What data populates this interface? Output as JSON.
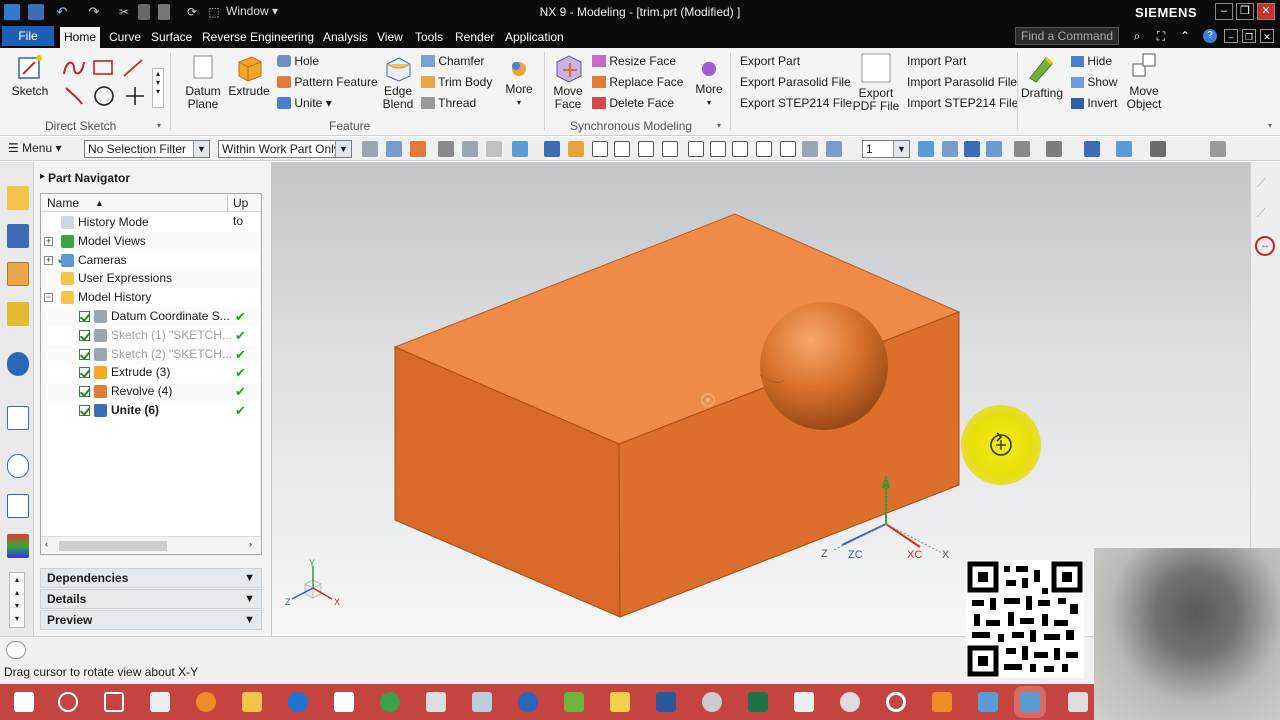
{
  "titlebar": {
    "window_menu": "Window",
    "title": "NX 9 - Modeling - [trim.prt (Modified) ]",
    "brand": "SIEMENS"
  },
  "tabs": [
    "File",
    "Home",
    "Curve",
    "Surface",
    "Reverse Engineering",
    "Analysis",
    "View",
    "Tools",
    "Render",
    "Application"
  ],
  "find_placeholder": "Find a Command",
  "ribbon": {
    "direct_sketch": {
      "sketch": "Sketch",
      "label": "Direct Sketch"
    },
    "feature": {
      "datum_plane": "Datum Plane",
      "extrude": "Extrude",
      "hole": "Hole",
      "pattern_feature": "Pattern Feature",
      "unite": "Unite",
      "edge_blend": "Edge Blend",
      "chamfer": "Chamfer",
      "trim_body": "Trim Body",
      "thread": "Thread",
      "more": "More",
      "label": "Feature"
    },
    "synchronous": {
      "move_face": "Move Face",
      "resize_face": "Resize Face",
      "replace_face": "Replace Face",
      "delete_face": "Delete Face",
      "more": "More",
      "label": "Synchronous Modeling"
    },
    "export": {
      "export_part": "Export Part",
      "export_parasolid": "Export Parasolid File",
      "export_step": "Export STEP214 File",
      "export_pdf": "Export PDF File",
      "import_part": "Import Part",
      "import_parasolid": "Import Parasolid File",
      "import_step": "Import STEP214 File"
    },
    "misc": {
      "drafting": "Drafting",
      "hide": "Hide",
      "show": "Show",
      "invert": "Invert",
      "move_object": "Move Object"
    }
  },
  "selection_bar": {
    "menu": "Menu",
    "type_filter": "No Selection Filter",
    "scope": "Within Work Part Only",
    "layer": "1"
  },
  "navigator": {
    "title": "Part Navigator",
    "col_name": "Name",
    "col_uptodate": "Up to",
    "rows": [
      {
        "label": "History Mode",
        "greyed": false,
        "bold": false
      },
      {
        "label": "Model Views",
        "greyed": false,
        "bold": false
      },
      {
        "label": "Cameras",
        "greyed": false,
        "bold": false
      },
      {
        "label": "User Expressions",
        "greyed": false,
        "bold": false
      },
      {
        "label": "Model History",
        "greyed": false,
        "bold": false
      },
      {
        "label": "Datum Coordinate S...",
        "greyed": false,
        "bold": false
      },
      {
        "label": "Sketch (1) \"SKETCH...",
        "greyed": true,
        "bold": false
      },
      {
        "label": "Sketch (2) \"SKETCH...",
        "greyed": true,
        "bold": false
      },
      {
        "label": "Extrude (3)",
        "greyed": false,
        "bold": false
      },
      {
        "label": "Revolve (4)",
        "greyed": false,
        "bold": false
      },
      {
        "label": "Unite (6)",
        "greyed": false,
        "bold": true
      }
    ],
    "panels": [
      "Dependencies",
      "Details",
      "Preview"
    ]
  },
  "triad": {
    "x": "X",
    "y": "Y",
    "z": "Z",
    "xc": "XC",
    "zc": "ZC"
  },
  "status": "Drag cursor to rotate view about X-Y",
  "colors": {
    "body": "#ef8a45",
    "accent": "#1d5fb4",
    "taskbar": "#c4443f"
  }
}
